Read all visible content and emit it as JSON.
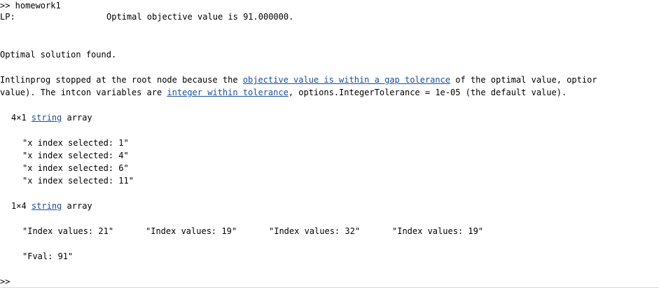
{
  "console": {
    "command_line": ">> homework1",
    "lp_label": "LP:",
    "lp_message": "Optimal objective value is 91.000000.",
    "solution_found": "Optimal solution found.",
    "stop_msg_part1": "Intlinprog stopped at the root node because the ",
    "stop_msg_link1": "objective value is within a gap tolerance",
    "stop_msg_part2": " of the optimal value, optior",
    "stop_msg_part3": "value). The intcon variables are ",
    "stop_msg_link2": "integer within tolerance",
    "stop_msg_part4": ", options.IntegerTolerance = 1e-05 (the default value).",
    "array1": {
      "size": "4×1",
      "type_link": "string",
      "type_suffix": "array",
      "items": [
        "\"x index selected: 1\"",
        "\"x index selected: 4\"",
        "\"x index selected: 6\"",
        "\"x index selected: 11\""
      ]
    },
    "array2": {
      "size": "1×4",
      "type_link": "string",
      "type_suffix": "array",
      "items": [
        "\"Index values: 21\"",
        "\"Index values: 19\"",
        "\"Index values: 32\"",
        "\"Index values: 19\""
      ]
    },
    "fval": "\"Fval: 91\"",
    "prompt": ">>"
  }
}
